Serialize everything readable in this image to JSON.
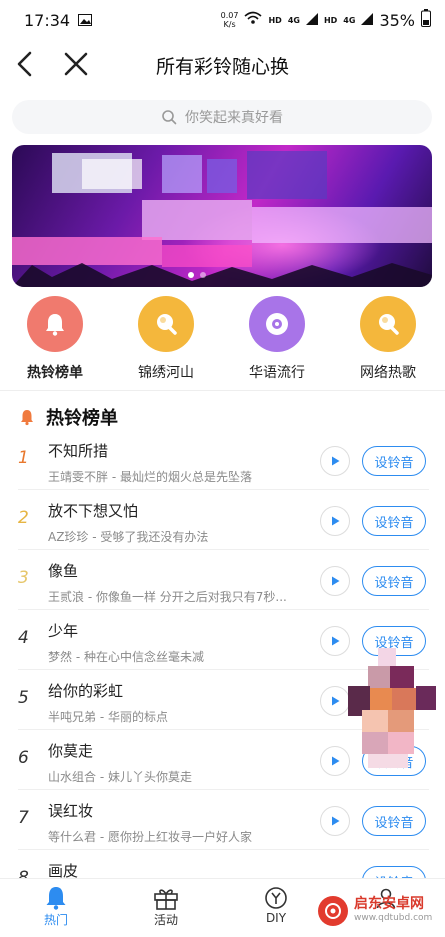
{
  "status": {
    "time": "17:34",
    "speed_value": "0.07",
    "speed_unit": "K/s",
    "hd1": "HD",
    "sig1": "4G",
    "hd2": "HD",
    "sig2": "4G",
    "battery": "35%"
  },
  "nav": {
    "title": "所有彩铃随心换"
  },
  "search": {
    "placeholder": "你笑起来真好看"
  },
  "banner": {
    "slide_count": 2,
    "active_slide": 1
  },
  "categories": [
    {
      "label": "热铃榜单",
      "icon": "bell-icon",
      "color": "#f07a6e"
    },
    {
      "label": "锦绣河山",
      "icon": "bulb-icon",
      "color": "#f4b73c"
    },
    {
      "label": "华语流行",
      "icon": "disc-icon",
      "color": "#a874e8"
    },
    {
      "label": "网络热歌",
      "icon": "bulb-icon",
      "color": "#f4b73c"
    }
  ],
  "section": {
    "title": "热铃榜单"
  },
  "songs": [
    {
      "rank": "1",
      "title": "不知所措",
      "sub": "王靖雯不胖 - 最灿烂的烟火总是先坠落"
    },
    {
      "rank": "2",
      "title": "放不下想又怕",
      "sub": "AZ珍珍 - 受够了我还没有办法"
    },
    {
      "rank": "3",
      "title": "像鱼",
      "sub": "王贰浪 - 你像鱼一样 分开之后对我只有7秒..."
    },
    {
      "rank": "4",
      "title": "少年",
      "sub": "梦然 - 种在心中信念丝毫未减"
    },
    {
      "rank": "5",
      "title": "给你的彩虹",
      "sub": "半吨兄弟 - 华丽的标点"
    },
    {
      "rank": "6",
      "title": "你莫走",
      "sub": "山水组合 - 妹儿丫头你莫走"
    },
    {
      "rank": "7",
      "title": "误红妆",
      "sub": "等什么君 - 愿你扮上红妆寻一户好人家"
    },
    {
      "rank": "8",
      "title": "画皮",
      "sub": ""
    }
  ],
  "set_label": "设铃音",
  "set_label_partial": "设铃音",
  "tabs": [
    {
      "label": "热门",
      "icon": "hot-icon"
    },
    {
      "label": "活动",
      "icon": "gift-icon"
    },
    {
      "label": "DIY",
      "icon": "diy-icon"
    },
    {
      "label": "",
      "icon": "profile-icon"
    }
  ],
  "watermark": {
    "cn": "启东安卓网",
    "url": "www.qdtubd.com"
  },
  "colors": {
    "accent": "#2d8cf0",
    "rank_top": "#e8782e",
    "rank_gold": "#e6b543"
  }
}
